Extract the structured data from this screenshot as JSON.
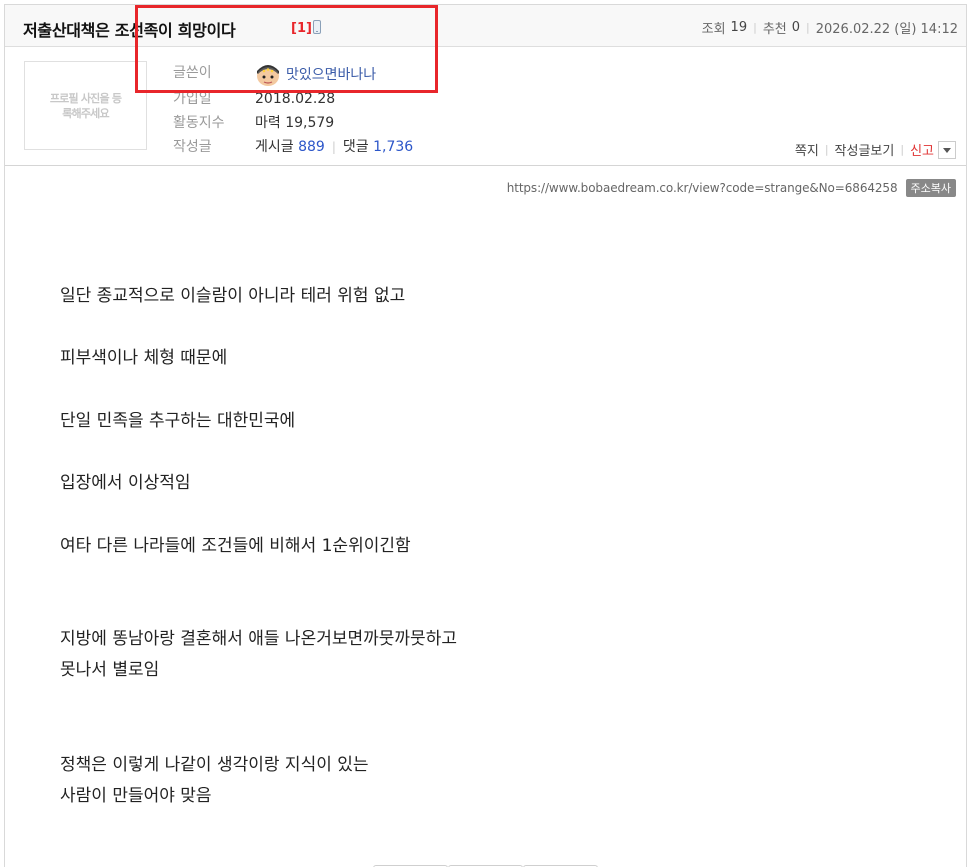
{
  "post": {
    "title": "저출산대책은 조선족이 희망이다",
    "comment_count": "[1]",
    "stats": {
      "views_label": "조회",
      "views": "19",
      "recommend_label": "추천",
      "recommend": "0",
      "datetime": "2026.02.22 (일) 14:12"
    }
  },
  "author": {
    "profile_placeholder": "프로필 사진을 등록해주세요",
    "labels": {
      "writer": "글쓴이",
      "joined": "가입일",
      "activity": "활동지수",
      "posts": "작성글"
    },
    "nickname": "맛있으면바나나",
    "joined": "2018.02.28",
    "activity_label": "마력",
    "activity_value": "19,579",
    "posts_label": "게시글",
    "posts_count": "889",
    "comments_label": "댓글",
    "comments_count": "1,736"
  },
  "actions": {
    "message": "쪽지",
    "view_posts": "작성글보기",
    "report": "신고"
  },
  "url_bar": {
    "url": "https://www.bobaedream.co.kr/view?code=strange&No=6864258",
    "copy_label": "주소복사"
  },
  "body_lines": [
    "일단 종교적으로 이슬람이 아니라 테러 위험 없고",
    "피부색이나 체형 때문에",
    "단일 민족을 추구하는 대한민국에",
    "입장에서 이상적임",
    "여타 다른 나라들에 조건들에 비해서  1순위이긴함",
    "지방에 똥남아랑 결혼해서 애들 나온거보면까뭇까뭇하고",
    "못나서 별로임",
    "정책은 이렇게 나같이 생각이랑 지식이 있는",
    "사람이 만들어야 맞음"
  ],
  "colors": {
    "highlight_box": "#e8262b",
    "nickname": "#3a5ba8",
    "count_link": "#2c56c9",
    "report": "#e03333"
  }
}
